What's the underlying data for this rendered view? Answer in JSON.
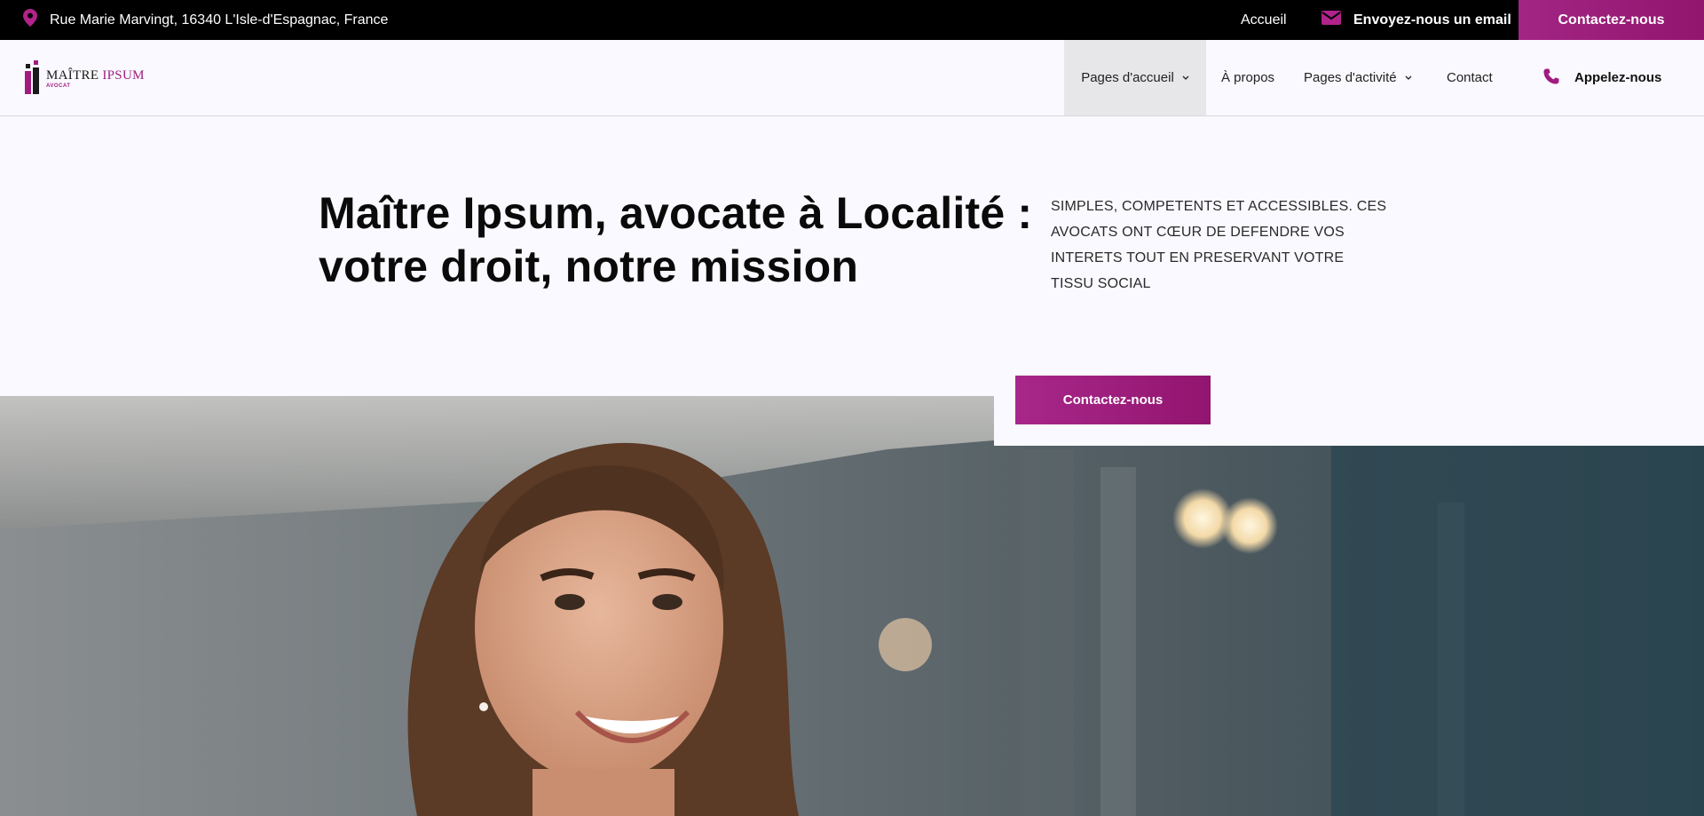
{
  "topbar": {
    "address": "Rue Marie Marvingt, 16340 L'Isle-d'Espagnac, France",
    "address_icon": "map-pin-icon",
    "home_link": "Accueil",
    "email_label": "Envoyez-nous un email",
    "email_icon": "envelope-icon",
    "cta_label": "Contactez-nous"
  },
  "logo": {
    "name_part1": "MAÎTRE ",
    "name_part2": "IPSUM",
    "subtitle": "AVOCAT"
  },
  "nav": {
    "items": [
      {
        "label": "Pages d'accueil",
        "has_dropdown": true,
        "active": true
      },
      {
        "label": "À propos",
        "has_dropdown": false,
        "active": false
      },
      {
        "label": "Pages d'activité",
        "has_dropdown": true,
        "active": false
      },
      {
        "label": "Contact",
        "has_dropdown": false,
        "active": false
      }
    ],
    "phone_label": "Appelez-nous",
    "phone_icon": "phone-icon"
  },
  "hero": {
    "title": "Maître Ipsum, avocate à Localité : votre droit, notre mission",
    "tagline": "SIMPLES, COMPETENTS ET ACCESSIBLES. CES AVOCATS ONT CŒUR DE DEFENDRE VOS INTERETS TOUT EN PRESERVANT VOTRE TISSU SOCIAL",
    "button_label": "Contactez-nous"
  },
  "colors": {
    "accent": "#a01c7e",
    "topbar_bg": "#000000",
    "page_bg": "#f9f9ff"
  }
}
